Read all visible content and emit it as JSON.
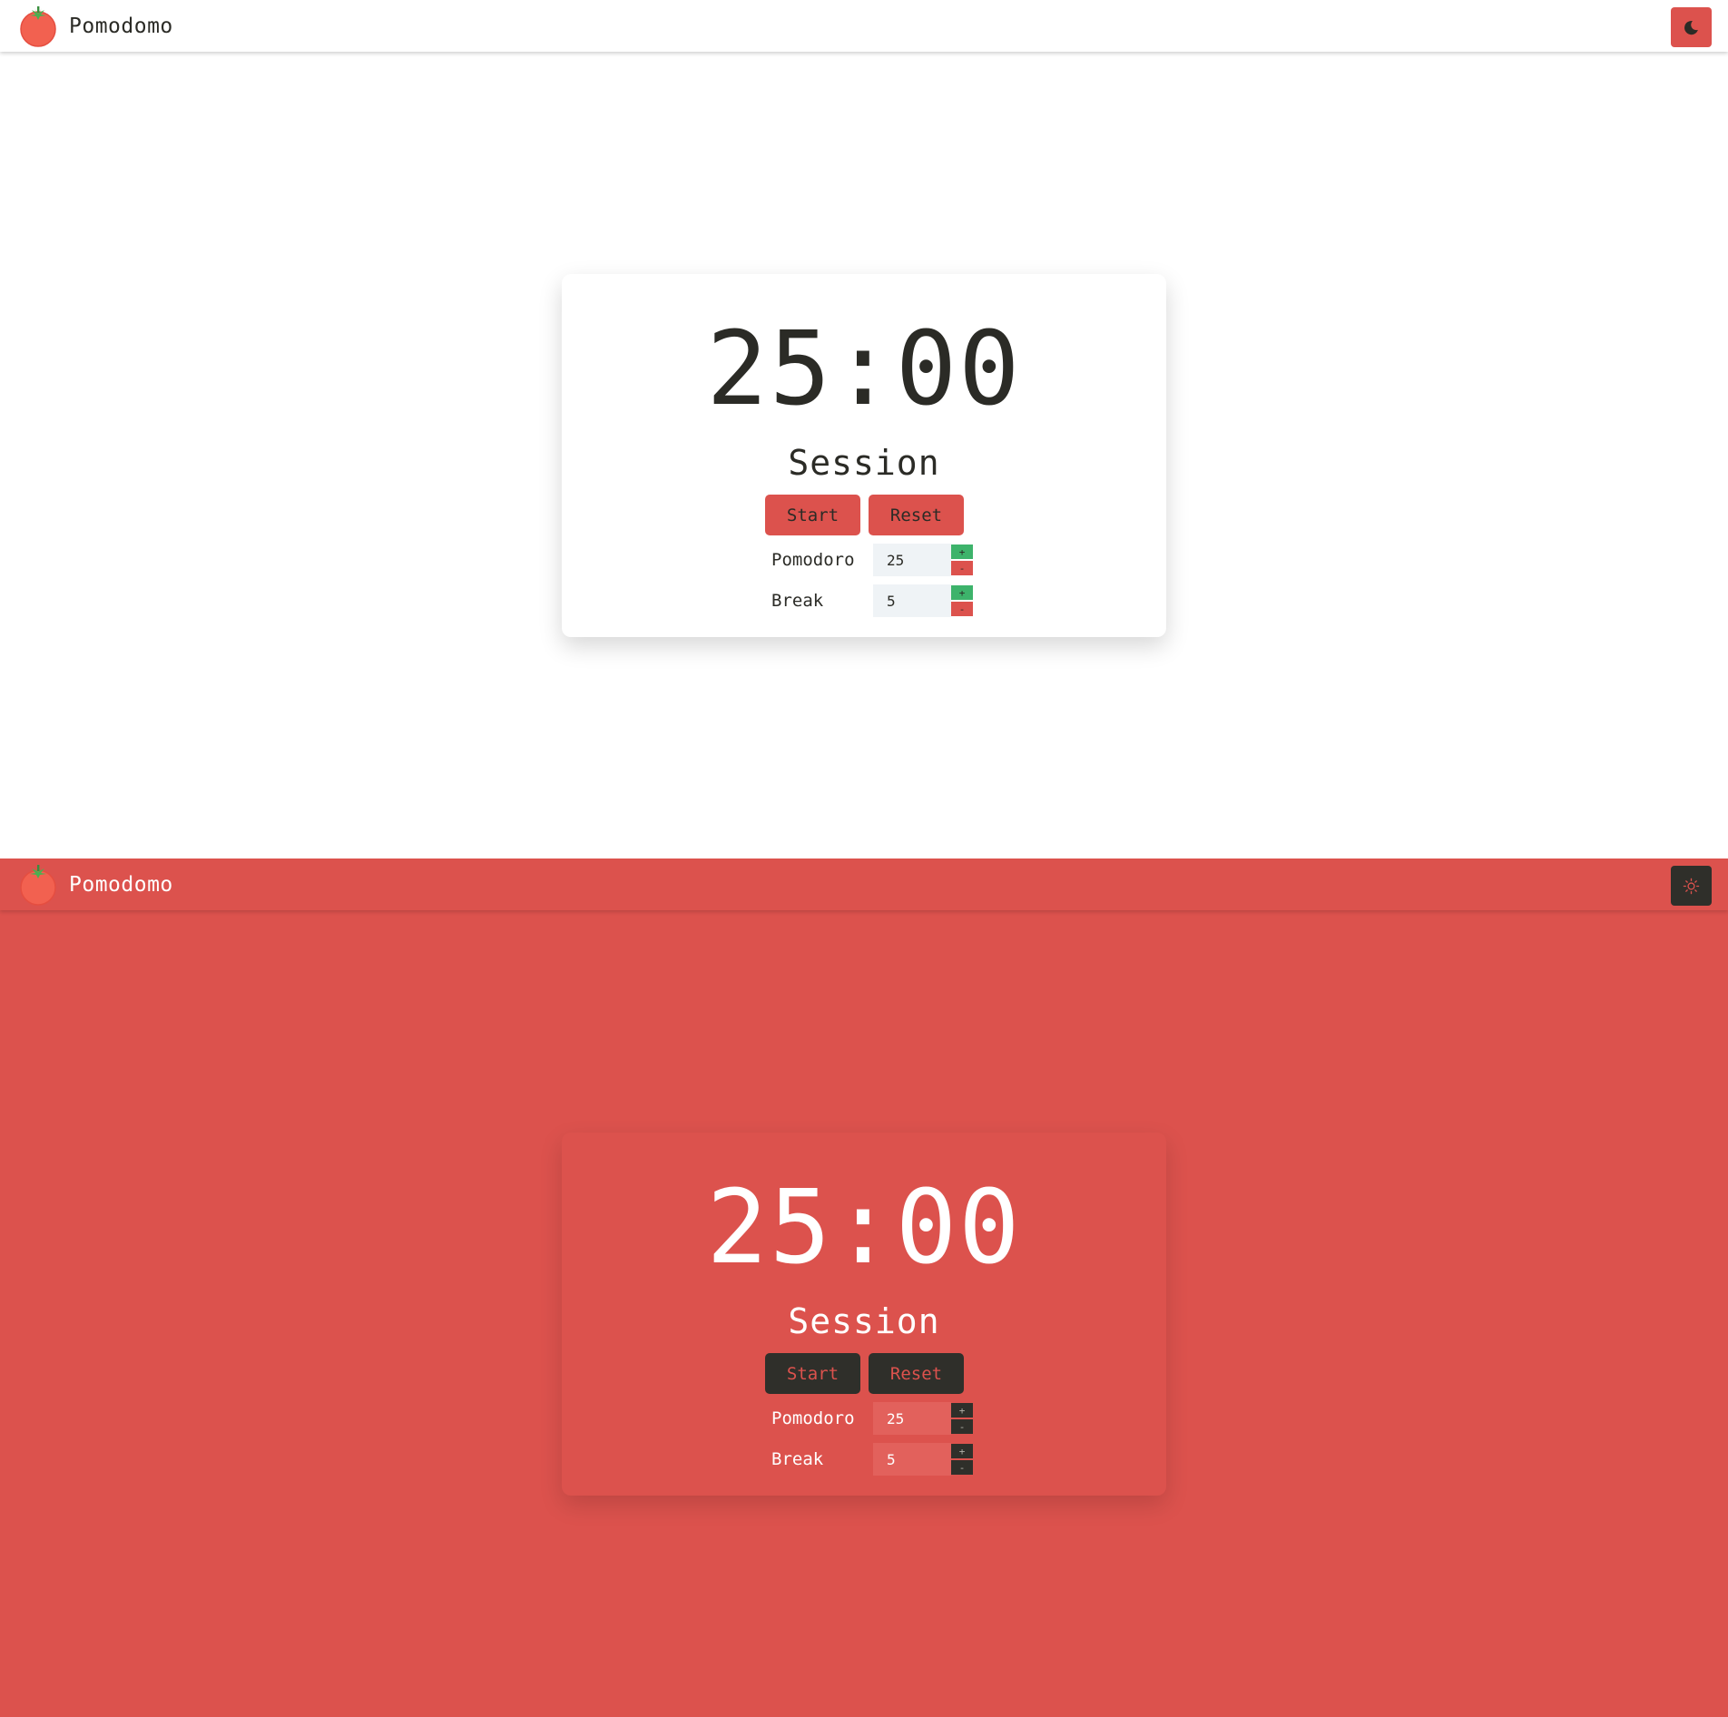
{
  "app": {
    "name": "Pomodomo"
  },
  "colors": {
    "accent": "#dc524d",
    "dark": "#2f2f2a",
    "increment": "#3db36b",
    "light_bg": "#ffffff",
    "input_bg": "#eff3f6"
  },
  "icons": {
    "logo": "tomato-icon",
    "toggle_light_theme": "moon-icon",
    "toggle_dark_theme": "sun-icon"
  },
  "timer": {
    "display": "25:00",
    "mode": "Session"
  },
  "controls": {
    "start_label": "Start",
    "reset_label": "Reset"
  },
  "settings": {
    "pomodoro": {
      "label": "Pomodoro",
      "value": "25"
    },
    "break": {
      "label": "Break",
      "value": "5"
    },
    "increment_symbol": "+",
    "decrement_symbol": "-"
  }
}
